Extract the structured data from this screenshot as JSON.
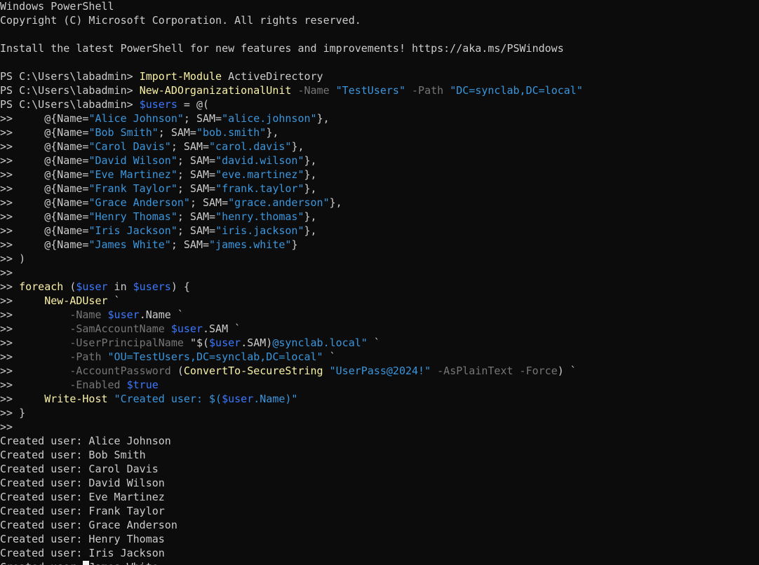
{
  "window": {
    "title": "Windows PowerShell"
  },
  "colors": {
    "background": "#0c0c0c",
    "foreground": "#cccccc",
    "command": "#f9f1a5",
    "string": "#3a96dd",
    "variable": "#3b78ff",
    "parameter": "#767676",
    "cursor": "#f2f2f2"
  },
  "lines": [
    {
      "name": "banner-title",
      "segments": [
        {
          "t": "Windows PowerShell",
          "c": "foreground"
        }
      ]
    },
    {
      "name": "banner-copyright",
      "segments": [
        {
          "t": "Copyright (C) Microsoft Corporation. All rights reserved.",
          "c": "foreground"
        }
      ]
    },
    {
      "name": "blank-line",
      "segments": []
    },
    {
      "name": "banner-install-hint",
      "segments": [
        {
          "t": "Install the latest PowerShell for new features and improvements! https://aka.ms/PSWindows",
          "c": "foreground"
        }
      ]
    },
    {
      "name": "blank-line",
      "segments": []
    },
    {
      "name": "prompt-line",
      "segments": [
        {
          "t": "PS C:\\Users\\labadmin> ",
          "c": "foreground"
        },
        {
          "t": "Import-Module",
          "c": "command"
        },
        {
          "t": " ActiveDirectory",
          "c": "foreground"
        }
      ]
    },
    {
      "name": "prompt-line",
      "segments": [
        {
          "t": "PS C:\\Users\\labadmin> ",
          "c": "foreground"
        },
        {
          "t": "New-ADOrganizationalUnit",
          "c": "command"
        },
        {
          "t": " -Name ",
          "c": "parameter"
        },
        {
          "t": "\"TestUsers\"",
          "c": "string"
        },
        {
          "t": " -Path ",
          "c": "parameter"
        },
        {
          "t": "\"DC=synclab,DC=local\"",
          "c": "string"
        }
      ]
    },
    {
      "name": "prompt-line",
      "segments": [
        {
          "t": "PS C:\\Users\\labadmin> ",
          "c": "foreground"
        },
        {
          "t": "$users",
          "c": "variable"
        },
        {
          "t": " = @(",
          "c": "foreground"
        }
      ]
    },
    {
      "name": "continuation-line",
      "segments": [
        {
          "t": ">>     @{Name=",
          "c": "foreground"
        },
        {
          "t": "\"Alice Johnson\"",
          "c": "string"
        },
        {
          "t": "; SAM=",
          "c": "foreground"
        },
        {
          "t": "\"alice.johnson\"",
          "c": "string"
        },
        {
          "t": "},",
          "c": "foreground"
        }
      ]
    },
    {
      "name": "continuation-line",
      "segments": [
        {
          "t": ">>     @{Name=",
          "c": "foreground"
        },
        {
          "t": "\"Bob Smith\"",
          "c": "string"
        },
        {
          "t": "; SAM=",
          "c": "foreground"
        },
        {
          "t": "\"bob.smith\"",
          "c": "string"
        },
        {
          "t": "},",
          "c": "foreground"
        }
      ]
    },
    {
      "name": "continuation-line",
      "segments": [
        {
          "t": ">>     @{Name=",
          "c": "foreground"
        },
        {
          "t": "\"Carol Davis\"",
          "c": "string"
        },
        {
          "t": "; SAM=",
          "c": "foreground"
        },
        {
          "t": "\"carol.davis\"",
          "c": "string"
        },
        {
          "t": "},",
          "c": "foreground"
        }
      ]
    },
    {
      "name": "continuation-line",
      "segments": [
        {
          "t": ">>     @{Name=",
          "c": "foreground"
        },
        {
          "t": "\"David Wilson\"",
          "c": "string"
        },
        {
          "t": "; SAM=",
          "c": "foreground"
        },
        {
          "t": "\"david.wilson\"",
          "c": "string"
        },
        {
          "t": "},",
          "c": "foreground"
        }
      ]
    },
    {
      "name": "continuation-line",
      "segments": [
        {
          "t": ">>     @{Name=",
          "c": "foreground"
        },
        {
          "t": "\"Eve Martinez\"",
          "c": "string"
        },
        {
          "t": "; SAM=",
          "c": "foreground"
        },
        {
          "t": "\"eve.martinez\"",
          "c": "string"
        },
        {
          "t": "},",
          "c": "foreground"
        }
      ]
    },
    {
      "name": "continuation-line",
      "segments": [
        {
          "t": ">>     @{Name=",
          "c": "foreground"
        },
        {
          "t": "\"Frank Taylor\"",
          "c": "string"
        },
        {
          "t": "; SAM=",
          "c": "foreground"
        },
        {
          "t": "\"frank.taylor\"",
          "c": "string"
        },
        {
          "t": "},",
          "c": "foreground"
        }
      ]
    },
    {
      "name": "continuation-line",
      "segments": [
        {
          "t": ">>     @{Name=",
          "c": "foreground"
        },
        {
          "t": "\"Grace Anderson\"",
          "c": "string"
        },
        {
          "t": "; SAM=",
          "c": "foreground"
        },
        {
          "t": "\"grace.anderson\"",
          "c": "string"
        },
        {
          "t": "},",
          "c": "foreground"
        }
      ]
    },
    {
      "name": "continuation-line",
      "segments": [
        {
          "t": ">>     @{Name=",
          "c": "foreground"
        },
        {
          "t": "\"Henry Thomas\"",
          "c": "string"
        },
        {
          "t": "; SAM=",
          "c": "foreground"
        },
        {
          "t": "\"henry.thomas\"",
          "c": "string"
        },
        {
          "t": "},",
          "c": "foreground"
        }
      ]
    },
    {
      "name": "continuation-line",
      "segments": [
        {
          "t": ">>     @{Name=",
          "c": "foreground"
        },
        {
          "t": "\"Iris Jackson\"",
          "c": "string"
        },
        {
          "t": "; SAM=",
          "c": "foreground"
        },
        {
          "t": "\"iris.jackson\"",
          "c": "string"
        },
        {
          "t": "},",
          "c": "foreground"
        }
      ]
    },
    {
      "name": "continuation-line",
      "segments": [
        {
          "t": ">>     @{Name=",
          "c": "foreground"
        },
        {
          "t": "\"James White\"",
          "c": "string"
        },
        {
          "t": "; SAM=",
          "c": "foreground"
        },
        {
          "t": "\"james.white\"",
          "c": "string"
        },
        {
          "t": "}",
          "c": "foreground"
        }
      ]
    },
    {
      "name": "continuation-line",
      "segments": [
        {
          "t": ">> )",
          "c": "foreground"
        }
      ]
    },
    {
      "name": "continuation-line",
      "segments": [
        {
          "t": ">>",
          "c": "foreground"
        }
      ]
    },
    {
      "name": "continuation-line",
      "segments": [
        {
          "t": ">> ",
          "c": "foreground"
        },
        {
          "t": "foreach",
          "c": "command"
        },
        {
          "t": " (",
          "c": "foreground"
        },
        {
          "t": "$user",
          "c": "variable"
        },
        {
          "t": " in ",
          "c": "foreground"
        },
        {
          "t": "$users",
          "c": "variable"
        },
        {
          "t": ") {",
          "c": "foreground"
        }
      ]
    },
    {
      "name": "continuation-line",
      "segments": [
        {
          "t": ">>     ",
          "c": "foreground"
        },
        {
          "t": "New-ADUser",
          "c": "command"
        },
        {
          "t": " `",
          "c": "foreground"
        }
      ]
    },
    {
      "name": "continuation-line",
      "segments": [
        {
          "t": ">>         ",
          "c": "foreground"
        },
        {
          "t": "-Name ",
          "c": "parameter"
        },
        {
          "t": "$user",
          "c": "variable"
        },
        {
          "t": ".Name `",
          "c": "foreground"
        }
      ]
    },
    {
      "name": "continuation-line",
      "segments": [
        {
          "t": ">>         ",
          "c": "foreground"
        },
        {
          "t": "-SamAccountName ",
          "c": "parameter"
        },
        {
          "t": "$user",
          "c": "variable"
        },
        {
          "t": ".SAM `",
          "c": "foreground"
        }
      ]
    },
    {
      "name": "continuation-line",
      "segments": [
        {
          "t": ">>         ",
          "c": "foreground"
        },
        {
          "t": "-UserPrincipalName ",
          "c": "parameter"
        },
        {
          "t": "\"$(",
          "c": "foreground"
        },
        {
          "t": "$user",
          "c": "variable"
        },
        {
          "t": ".SAM)",
          "c": "foreground"
        },
        {
          "t": "@synclab.local\"",
          "c": "string"
        },
        {
          "t": " `",
          "c": "foreground"
        }
      ]
    },
    {
      "name": "continuation-line",
      "segments": [
        {
          "t": ">>         ",
          "c": "foreground"
        },
        {
          "t": "-Path ",
          "c": "parameter"
        },
        {
          "t": "\"OU=TestUsers,DC=synclab,DC=local\"",
          "c": "string"
        },
        {
          "t": " `",
          "c": "foreground"
        }
      ]
    },
    {
      "name": "continuation-line",
      "segments": [
        {
          "t": ">>         ",
          "c": "foreground"
        },
        {
          "t": "-AccountPassword ",
          "c": "parameter"
        },
        {
          "t": "(",
          "c": "foreground"
        },
        {
          "t": "ConvertTo-SecureString",
          "c": "command"
        },
        {
          "t": " ",
          "c": "foreground"
        },
        {
          "t": "\"UserPass@2024!\"",
          "c": "string"
        },
        {
          "t": " -AsPlainText -Force",
          "c": "parameter"
        },
        {
          "t": ") `",
          "c": "foreground"
        }
      ]
    },
    {
      "name": "continuation-line",
      "segments": [
        {
          "t": ">>         ",
          "c": "foreground"
        },
        {
          "t": "-Enabled ",
          "c": "parameter"
        },
        {
          "t": "$true",
          "c": "variable"
        }
      ]
    },
    {
      "name": "continuation-line",
      "segments": [
        {
          "t": ">>     ",
          "c": "foreground"
        },
        {
          "t": "Write-Host",
          "c": "command"
        },
        {
          "t": " ",
          "c": "foreground"
        },
        {
          "t": "\"Created user: $(",
          "c": "string"
        },
        {
          "t": "$user",
          "c": "variable"
        },
        {
          "t": ".Name)\"",
          "c": "string"
        }
      ]
    },
    {
      "name": "continuation-line",
      "segments": [
        {
          "t": ">> }",
          "c": "foreground"
        }
      ]
    },
    {
      "name": "continuation-line",
      "segments": [
        {
          "t": ">>",
          "c": "foreground"
        }
      ]
    },
    {
      "name": "output-line",
      "segments": [
        {
          "t": "Created user: Alice Johnson",
          "c": "foreground"
        }
      ]
    },
    {
      "name": "output-line",
      "segments": [
        {
          "t": "Created user: Bob Smith",
          "c": "foreground"
        }
      ]
    },
    {
      "name": "output-line",
      "segments": [
        {
          "t": "Created user: Carol Davis",
          "c": "foreground"
        }
      ]
    },
    {
      "name": "output-line",
      "segments": [
        {
          "t": "Created user: David Wilson",
          "c": "foreground"
        }
      ]
    },
    {
      "name": "output-line",
      "segments": [
        {
          "t": "Created user: Eve Martinez",
          "c": "foreground"
        }
      ]
    },
    {
      "name": "output-line",
      "segments": [
        {
          "t": "Created user: Frank Taylor",
          "c": "foreground"
        }
      ]
    },
    {
      "name": "output-line",
      "segments": [
        {
          "t": "Created user: Grace Anderson",
          "c": "foreground"
        }
      ]
    },
    {
      "name": "output-line",
      "segments": [
        {
          "t": "Created user: Henry Thomas",
          "c": "foreground"
        }
      ]
    },
    {
      "name": "output-line",
      "segments": [
        {
          "t": "Created user: Iris Jackson",
          "c": "foreground"
        }
      ]
    },
    {
      "name": "output-line",
      "segments": [
        {
          "t": "Created user: James White",
          "c": "foreground"
        }
      ]
    }
  ]
}
